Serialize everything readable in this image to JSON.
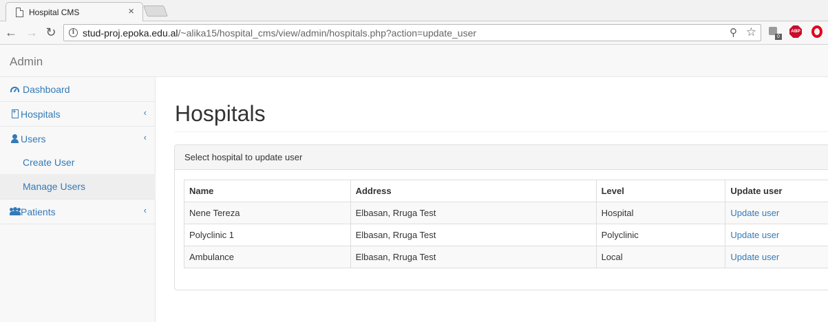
{
  "browser": {
    "tab_title": "Hospital CMS",
    "tab_close": "×",
    "url_host": "stud-proj.epoka.edu.al",
    "url_path": "/~alika15/hospital_cms/view/admin/hospitals.php?action=update_user",
    "extension_badge": "0",
    "abp_label": "ABP"
  },
  "navbar": {
    "brand": "Admin"
  },
  "sidebar": {
    "items": [
      {
        "label": "Dashboard",
        "icon": "dashboard-icon"
      },
      {
        "label": "Hospitals",
        "icon": "hospital-icon",
        "chevron": "‹"
      },
      {
        "label": "Users",
        "icon": "user-icon",
        "chevron": "‹"
      },
      {
        "label": "Patients",
        "icon": "users-icon",
        "chevron": "‹"
      }
    ],
    "subitems": [
      {
        "label": "Create User"
      },
      {
        "label": "Manage Users",
        "active": true
      }
    ]
  },
  "main": {
    "title": "Hospitals",
    "panel_heading": "Select hospital to update user",
    "table": {
      "headers": [
        "Name",
        "Address",
        "Level",
        "Update user"
      ],
      "rows": [
        {
          "name": "Nene Tereza",
          "address": "Elbasan, Rruga Test",
          "level": "Hospital",
          "action": "Update user"
        },
        {
          "name": "Polyclinic 1",
          "address": "Elbasan, Rruga Test",
          "level": "Polyclinic",
          "action": "Update user"
        },
        {
          "name": "Ambulance",
          "address": "Elbasan, Rruga Test",
          "level": "Local",
          "action": "Update user"
        }
      ]
    }
  },
  "colors": {
    "link": "#337ab7",
    "sidebar_bg": "#f8f8f8",
    "active_bg": "#eeeeee"
  }
}
